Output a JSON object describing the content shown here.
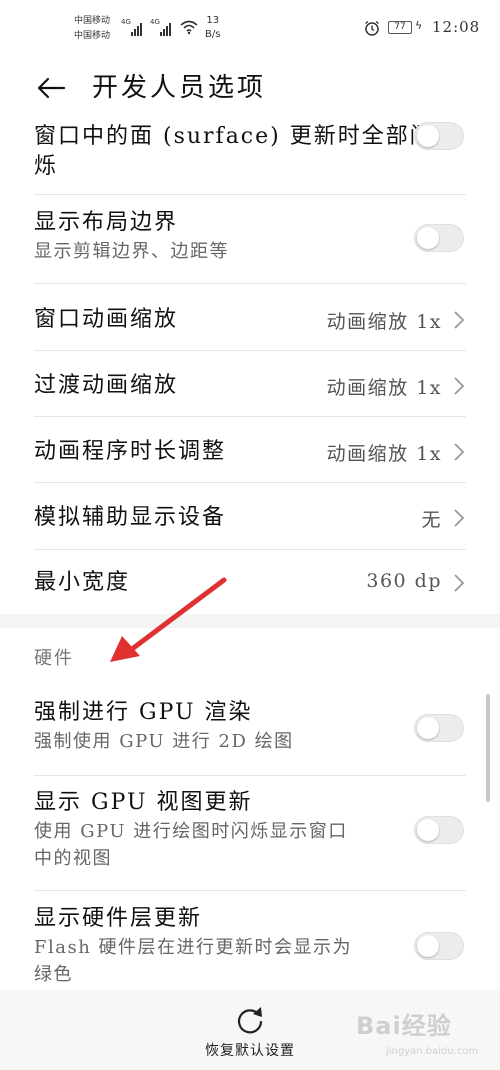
{
  "status_bar": {
    "carrier_1": "中国移动",
    "carrier_2": "中国移动",
    "net_1": "4G",
    "net_2": "4G",
    "speed_value": "13",
    "speed_unit": "B/s",
    "battery": "77",
    "time": "12:08"
  },
  "header": {
    "title": "开发人员选项"
  },
  "items": [
    {
      "title": "窗口中的面 (surface) 更新时全部闪",
      "title_2": "烁",
      "toggle": "off"
    },
    {
      "title": "显示布局边界",
      "subtitle": "显示剪辑边界、边距等",
      "toggle": "off"
    },
    {
      "title": "窗口动画缩放",
      "value": "动画缩放 1x"
    },
    {
      "title": "过渡动画缩放",
      "value": "动画缩放 1x"
    },
    {
      "title": "动画程序时长调整",
      "value": "动画缩放 1x"
    },
    {
      "title": "模拟辅助显示设备",
      "value": "无"
    },
    {
      "title": "最小宽度",
      "value": "360 dp"
    }
  ],
  "hardware": {
    "header": "硬件",
    "items": [
      {
        "title": "强制进行 GPU 渲染",
        "subtitle": "强制使用 GPU 进行 2D 绘图",
        "toggle": "off"
      },
      {
        "title": "显示 GPU 视图更新",
        "subtitle": "使用 GPU 进行绘图时闪烁显示窗口",
        "subtitle_2": "中的视图",
        "toggle": "off"
      },
      {
        "title": "显示硬件层更新",
        "subtitle": "Flash 硬件层在进行更新时会显示为",
        "subtitle_2": "绿色",
        "toggle": "off"
      }
    ]
  },
  "footer": {
    "reset_label": "恢复默认设置"
  },
  "watermark": {
    "main": "Bai经验",
    "sub": "jingyan.baidu.com"
  },
  "icons": {
    "back": "arrow-left-icon",
    "chevron": "chevron-right-icon",
    "reset": "refresh-icon",
    "annotation": "red-arrow-icon"
  },
  "colors": {
    "annotation_arrow": "#e03030",
    "toggle_off": "#ececec",
    "section_gap": "#f4f4f4"
  }
}
